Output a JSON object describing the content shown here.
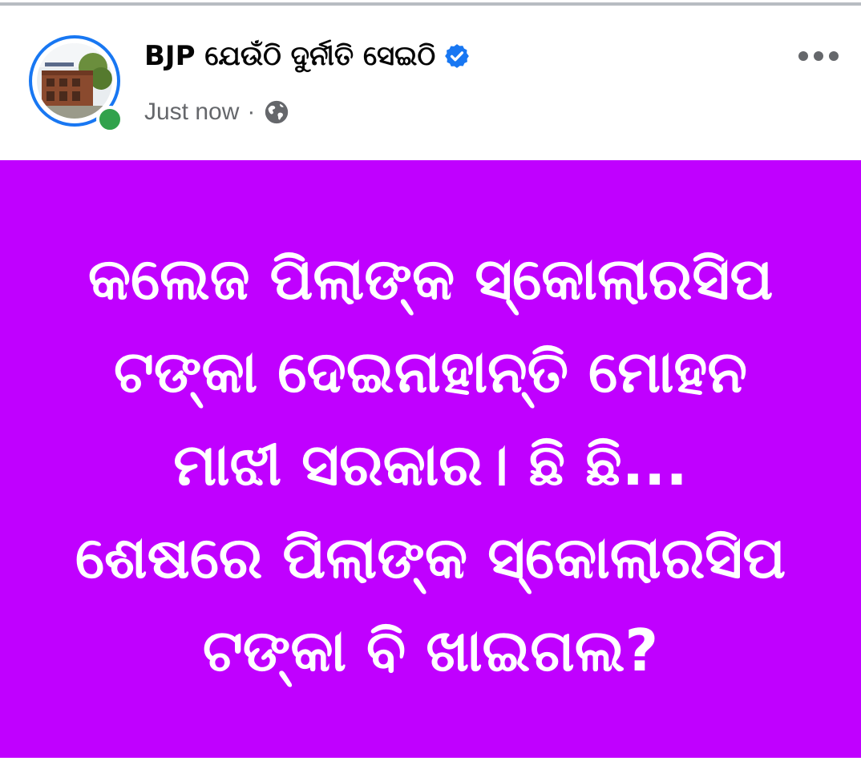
{
  "post": {
    "page_name": "BJP ଯେଉଁଠି ଦୁର୍ନୀତି ସେଇଠି",
    "verified": true,
    "timestamp": "Just now",
    "separator": "·",
    "audience_icon": "globe-icon",
    "more_icon": "more-options-icon"
  },
  "card": {
    "background_color": "#c000ff",
    "text_color": "#ffffff",
    "lines": [
      "କଲେଜ ପିଲାଙ୍କ ସ୍କୋଲାରସିପ",
      "ଟଙ୍କା ଦେଇନାହାନ୍ତି ମୋହନ",
      "ମାଝୀ ସରକାର। ଛି ଛି...",
      "ଶେଷରେ ପିଲାଙ୍କ ସ୍କୋଲାରସିପ",
      "ଟଙ୍କା ବି ଖାଇଗଲ?"
    ]
  },
  "colors": {
    "verified_blue": "#1877f2",
    "online_green": "#31a24c",
    "meta_gray": "#65676b"
  }
}
